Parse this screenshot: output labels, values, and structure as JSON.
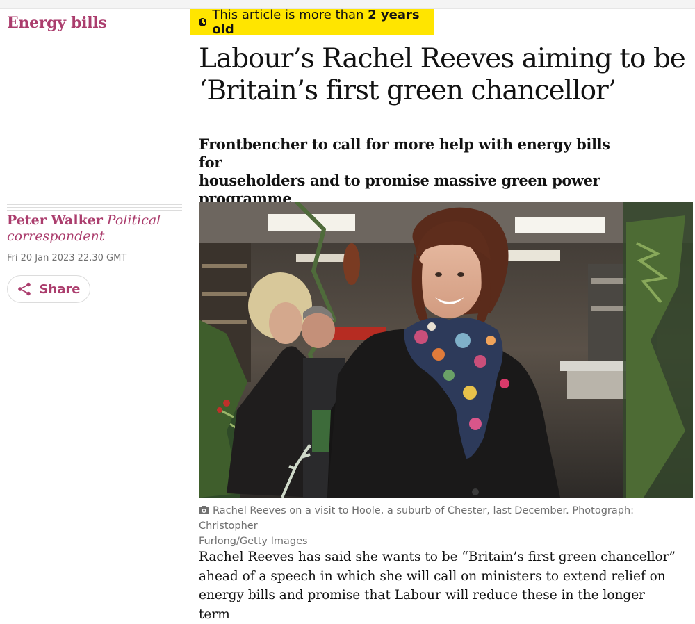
{
  "section": {
    "label": "Energy bills"
  },
  "age_banner": {
    "prefix": "This article is more than ",
    "emphasis": "2 years old",
    "icon": "clock-icon"
  },
  "headline": {
    "line1": "Labour’s Rachel Reeves aiming to be",
    "line2": "‘Britain’s first green chancellor’"
  },
  "standfirst": {
    "line1": "Frontbencher to call for more help with energy bills for",
    "line2": "householders and to promise massive green power",
    "line3": "programme"
  },
  "byline": {
    "name": "Peter Walker",
    "role": "Political correspondent",
    "date": "Fri 20 Jan 2023 22.30 GMT"
  },
  "share": {
    "label": "Share",
    "icon": "share-icon"
  },
  "image": {
    "subject": "Rachel Reeves smiling in a florist's shop surrounded by greenery"
  },
  "caption": {
    "line1": "Rachel Reeves on a visit to Hoole, a suburb of Chester, last December. Photograph: Christopher",
    "line2": "Furlong/Getty Images",
    "icon": "camera-icon"
  },
  "body": {
    "line1": "Rachel Reeves has said she wants to be “Britain’s first green chancellor”",
    "line2": "ahead of a speech in which she will call on ministers to extend relief on",
    "line3": "energy bills and promise that Labour will reduce these in the longer term"
  },
  "colors": {
    "accent": "#ab3d6d",
    "banner": "#ffe500",
    "text": "#121212",
    "muted": "#707070"
  }
}
